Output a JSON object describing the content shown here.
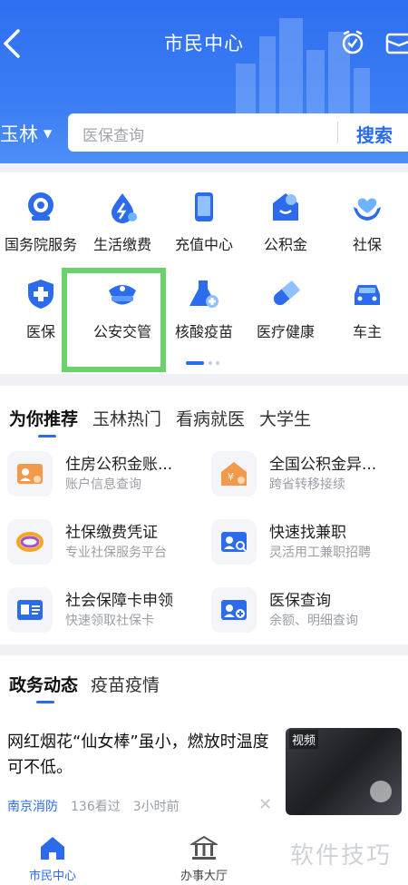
{
  "header": {
    "title": "市民中心",
    "city": "玉林",
    "search_placeholder": "医保查询",
    "search_button": "搜索"
  },
  "grid": {
    "items": [
      {
        "label": "国务院服务",
        "icon": "government-service-icon"
      },
      {
        "label": "生活缴费",
        "icon": "utility-bill-icon"
      },
      {
        "label": "充值中心",
        "icon": "phone-recharge-icon"
      },
      {
        "label": "公积金",
        "icon": "housing-fund-icon"
      },
      {
        "label": "社保",
        "icon": "social-security-icon"
      },
      {
        "label": "医保",
        "icon": "medical-insurance-icon"
      },
      {
        "label": "公安交管",
        "icon": "police-cap-icon"
      },
      {
        "label": "核酸疫苗",
        "icon": "flask-icon"
      },
      {
        "label": "医疗健康",
        "icon": "pill-icon"
      },
      {
        "label": "车主",
        "icon": "car-icon"
      }
    ]
  },
  "recommend": {
    "tabs": [
      "为你推荐",
      "玉林热门",
      "看病就医",
      "大学生"
    ],
    "items": [
      {
        "title": "住房公积金账...",
        "subtitle": "账户信息查询",
        "icon": "account-card-icon"
      },
      {
        "title": "全国公积金异...",
        "subtitle": "跨省转移接续",
        "icon": "house-yuan-icon"
      },
      {
        "title": "社保缴费凭证",
        "subtitle": "专业社保服务平台",
        "icon": "ring-logo-icon"
      },
      {
        "title": "快速找兼职",
        "subtitle": "灵活用工兼职招聘",
        "icon": "id-search-icon"
      },
      {
        "title": "社会保障卡申领",
        "subtitle": "快速领取社保卡",
        "icon": "id-card-icon"
      },
      {
        "title": "医保查询",
        "subtitle": "余额、明细查询",
        "icon": "id-plus-icon"
      }
    ]
  },
  "news": {
    "tabs": [
      "政务动态",
      "疫苗疫情"
    ],
    "headline": "网红烟花“仙女棒”虽小，燃放时温度可不低。",
    "source": "南京消防",
    "views": "136看过",
    "time": "3小时前",
    "thumb_label": "视频"
  },
  "bottom_nav": [
    {
      "label": "市民中心",
      "icon": "home-icon"
    },
    {
      "label": "办事大厅",
      "icon": "hall-icon"
    }
  ],
  "watermark": "软件技巧",
  "colors": {
    "primary": "#2b6bec",
    "highlight": "#6bd26b"
  }
}
